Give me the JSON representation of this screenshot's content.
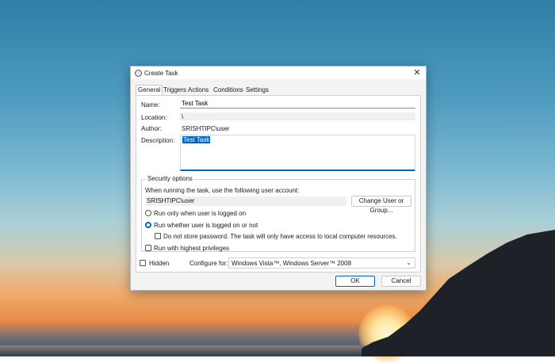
{
  "window": {
    "title": "Create Task",
    "close_glyph": "✕"
  },
  "tabs": [
    {
      "label": "General"
    },
    {
      "label": "Triggers"
    },
    {
      "label": "Actions"
    },
    {
      "label": "Conditions"
    },
    {
      "label": "Settings"
    }
  ],
  "general": {
    "name_label": "Name:",
    "name_value": "Test Task",
    "location_label": "Location:",
    "location_value": "\\",
    "author_label": "Author:",
    "author_value": "SRISHTIPC\\user",
    "description_label": "Description:",
    "description_value": "Test Task"
  },
  "security": {
    "title": "Security options",
    "account_prompt": "When running the task, use the following user account:",
    "account_value": "SRISHTIPC\\user",
    "change_user_label": "Change User or Group...",
    "radio_logged_on": "Run only when user is logged on",
    "radio_whether": "Run whether user is logged on or not",
    "radio_selected": "whether",
    "no_store_password": "Do not store password.  The task will only have access to local computer resources.",
    "highest_privileges": "Run with highest privileges"
  },
  "footer": {
    "hidden_label": "Hidden",
    "configure_label": "Configure for:",
    "configure_value": "Windows Vista™, Windows Server™ 2008",
    "ok_label": "OK",
    "cancel_label": "Cancel"
  },
  "icons": {
    "title": "clock-icon",
    "close": "close-icon",
    "dropdown": "chevron-down-icon"
  },
  "colors": {
    "accent": "#0067c0",
    "window_bg": "#f3f3f3"
  }
}
